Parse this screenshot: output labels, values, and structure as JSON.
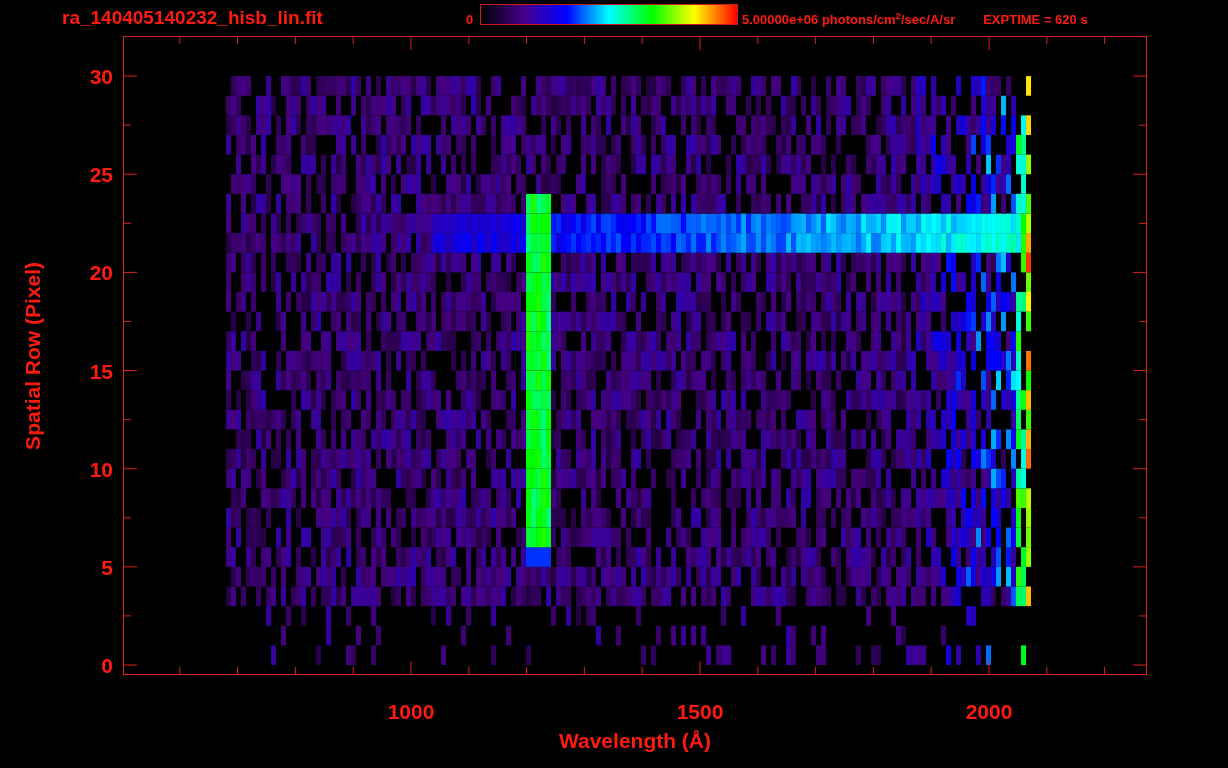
{
  "title": "ra_140405140232_hisb_lin.fit",
  "colorbar": {
    "min_label": "0",
    "max_label": "5.00000e+06 photons/cm$^{2}$/sec/A/sr"
  },
  "exposure": "EXPTIME = 620 s",
  "plot": {
    "xlabel": "Wavelength (Å)",
    "ylabel": "Spatial Row (Pixel)",
    "xtick_labels": [
      "1000",
      "1500",
      "2000"
    ],
    "ytick_labels": [
      "30",
      "25",
      "20",
      "15",
      "10",
      "5",
      "0"
    ]
  }
}
